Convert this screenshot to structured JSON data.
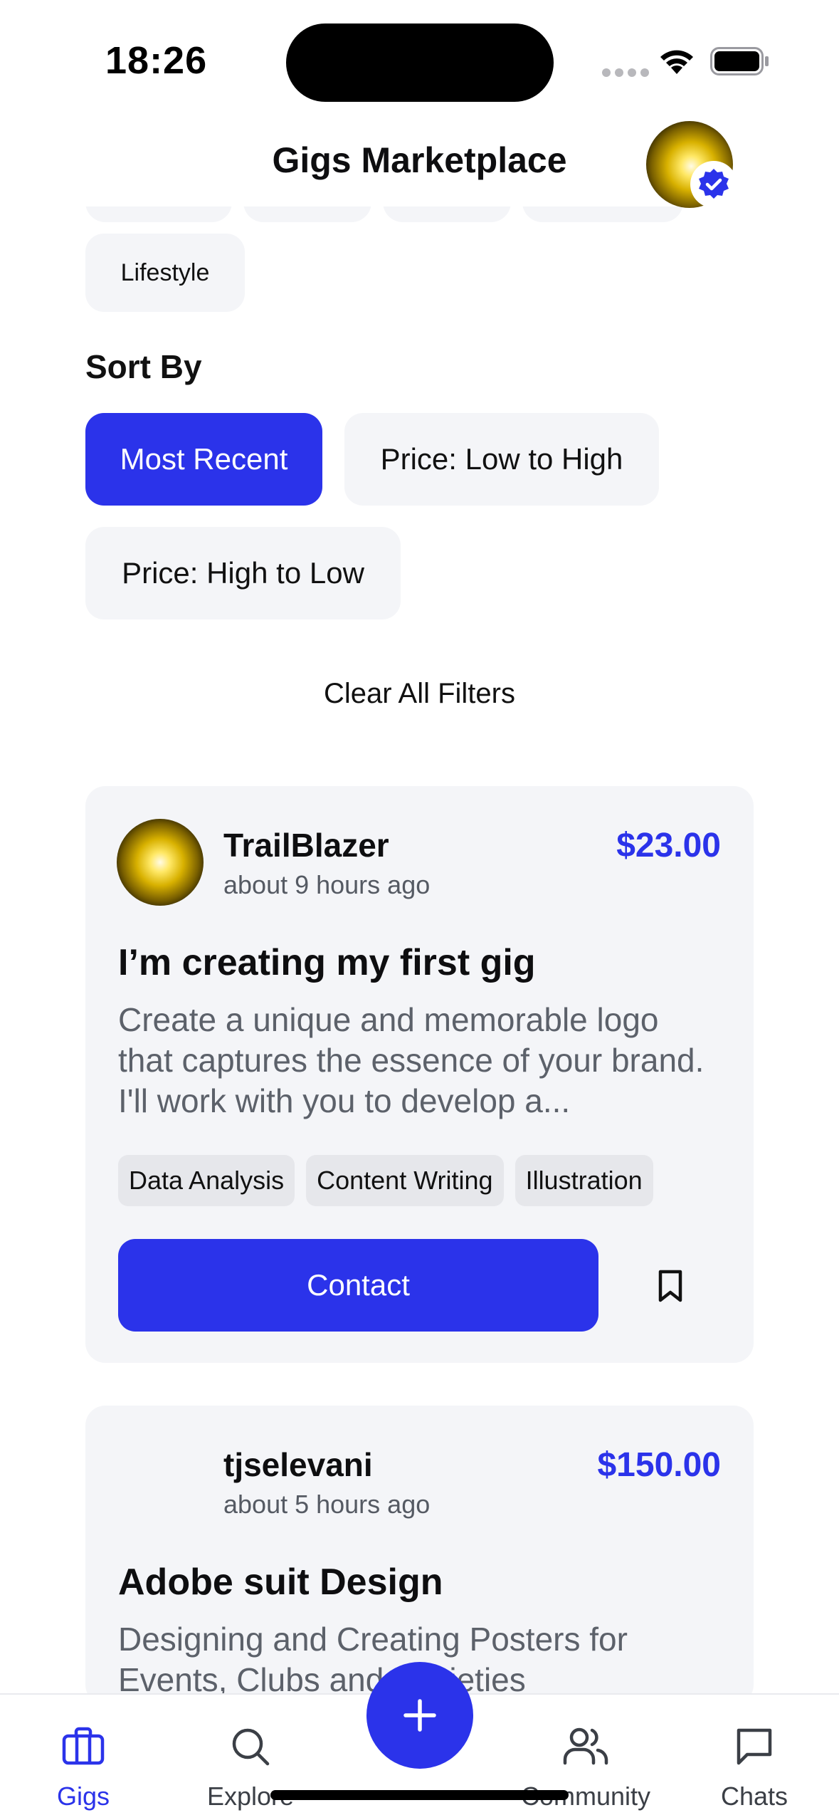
{
  "status_bar": {
    "time": "18:26"
  },
  "header": {
    "title": "Gigs Marketplace"
  },
  "categories": {
    "visible_chip": "Lifestyle"
  },
  "sort": {
    "label": "Sort By",
    "options": [
      "Most Recent",
      "Price: Low to High",
      "Price: High to Low"
    ],
    "selected": "Most Recent"
  },
  "clear_filters_label": "Clear All Filters",
  "gigs": [
    {
      "author": "TrailBlazer",
      "time": "about 9 hours ago",
      "price": "$23.00",
      "title": "I’m creating my first gig",
      "description": "Create a unique and memorable logo that captures the essence of your brand. I'll work with you to develop a...",
      "tags": [
        "Data Analysis",
        "Content Writing",
        "Illustration"
      ],
      "contact_label": "Contact"
    },
    {
      "author": "tjselevani",
      "time": "about 5 hours ago",
      "price": "$150.00",
      "title": "Adobe suit Design",
      "description": "Designing and Creating Posters for Events, Clubs and Societies"
    }
  ],
  "nav": {
    "items": [
      {
        "label": "Gigs",
        "icon": "briefcase-icon",
        "active": true
      },
      {
        "label": "Explore",
        "icon": "search-icon",
        "active": false
      },
      {
        "label": "Community",
        "icon": "users-icon",
        "active": false
      },
      {
        "label": "Chats",
        "icon": "chat-icon",
        "active": false
      }
    ],
    "fab_icon": "plus-icon"
  },
  "colors": {
    "accent": "#2B33EA",
    "chip_bg": "#F4F5F8",
    "tag_bg": "#E6E7EB",
    "muted_text": "#5C616A"
  }
}
